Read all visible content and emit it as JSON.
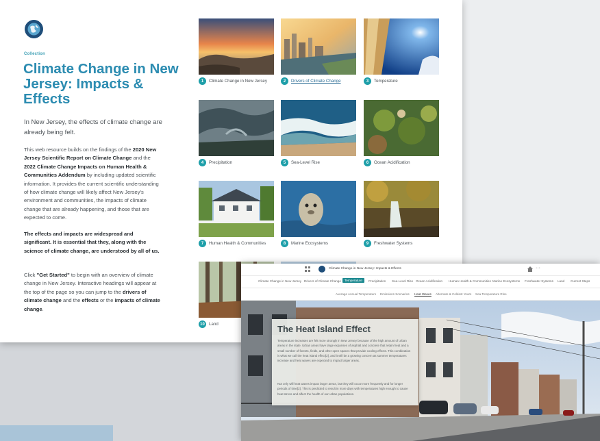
{
  "page": {
    "collection_label": "Collection",
    "title": "Climate Change in New Jersey: Impacts & Effects",
    "lead": "In New Jersey, the effects of climate change are already being felt.",
    "p1": {
      "t1": "This web resource builds on the findings of the ",
      "b1": "2020 New Jersey Scientific Report on Climate Change",
      "t2": " and the ",
      "b2": "2022 Climate Change Impacts on Human Health & Communities Addendum",
      "t3": " by including updated scientific information. It provides the current scientific understanding of how climate change will likely affect New Jersey's environment and communities, the impacts of climate change that are already happening, and those that are expected to come."
    },
    "p2": "The effects and impacts are widespread and significant. It is essential that they, along with the science of climate change, are understood by all of us.",
    "p3": {
      "t1": "Click ",
      "b1": "\"Get Started\"",
      "t2": " to begin with an overview of climate change in New Jersey. Interactive headings will appear at the top of the page so you can jump to the ",
      "b2": "drivers of climate change",
      "t3": " and the ",
      "b3": "effects",
      "t4": " or the ",
      "b4": "impacts of climate change",
      "t5": "."
    }
  },
  "tiles": [
    {
      "num": "1",
      "label": "Climate Change in New Jersey",
      "image": "sunset-coast"
    },
    {
      "num": "2",
      "label": "Drivers of Climate Change",
      "image": "city-skyline"
    },
    {
      "num": "3",
      "label": "Temperature",
      "image": "thermometer-sky"
    },
    {
      "num": "4",
      "label": "Precipitation",
      "image": "storm-clouds"
    },
    {
      "num": "5",
      "label": "Sea-Level Rise",
      "image": "ocean-waves"
    },
    {
      "num": "6",
      "label": "Ocean Acidification",
      "image": "coral-reef"
    },
    {
      "num": "7",
      "label": "Human Health & Communities",
      "image": "house-family"
    },
    {
      "num": "8",
      "label": "Marine Ecosystems",
      "image": "seal"
    },
    {
      "num": "9",
      "label": "Freshwater Systems",
      "image": "forest-waterfall"
    },
    {
      "num": "10",
      "label": "Land",
      "image": "forest"
    }
  ],
  "overlay": {
    "app_title": "Climate Change in New Jersey: Impacts & Effects",
    "nav": [
      "Climate Change in New Jersey",
      "Drivers of Climate Change",
      "Temperature",
      "Precipitation",
      "Sea-Level Rise",
      "Ocean Acidification",
      "Human Health & Communities",
      "Marine Ecosystems",
      "Freshwater Systems",
      "Land",
      "Current Steps"
    ],
    "nav_active": "Temperature",
    "subnav": [
      "Average Annual Temperature",
      "Emissions Scenarios",
      "Heat Waves",
      "Alternate & Coldest Years",
      "Sea Temperature Rise"
    ],
    "subnav_active": "Heat Waves",
    "panel_title": "The Heat Island Effect",
    "panel_p1": "Temperature increases are felt more strongly in New Jersey because of the high amount of urban areas in the state. Urban areas have large expanses of asphalt and concrete that retain heat and a small number of forests, fields, and other open spaces that provide cooling effects. This combination is what we call the heat island effect[2], and it will be a growing concern as summer temperatures increase and heat waves are expected to impact larger areas.",
    "panel_p2": "Not only will heat waves impact larger areas, but they will occur more frequently and for longer periods of time[3]. This is predicted to result in more days with temperatures high enough to cause heat stress and affect the health of our urban populations."
  },
  "colors": {
    "accent": "#2c8cb1",
    "badge": "#1e9fa9",
    "nav_active": "#1e8a91"
  }
}
